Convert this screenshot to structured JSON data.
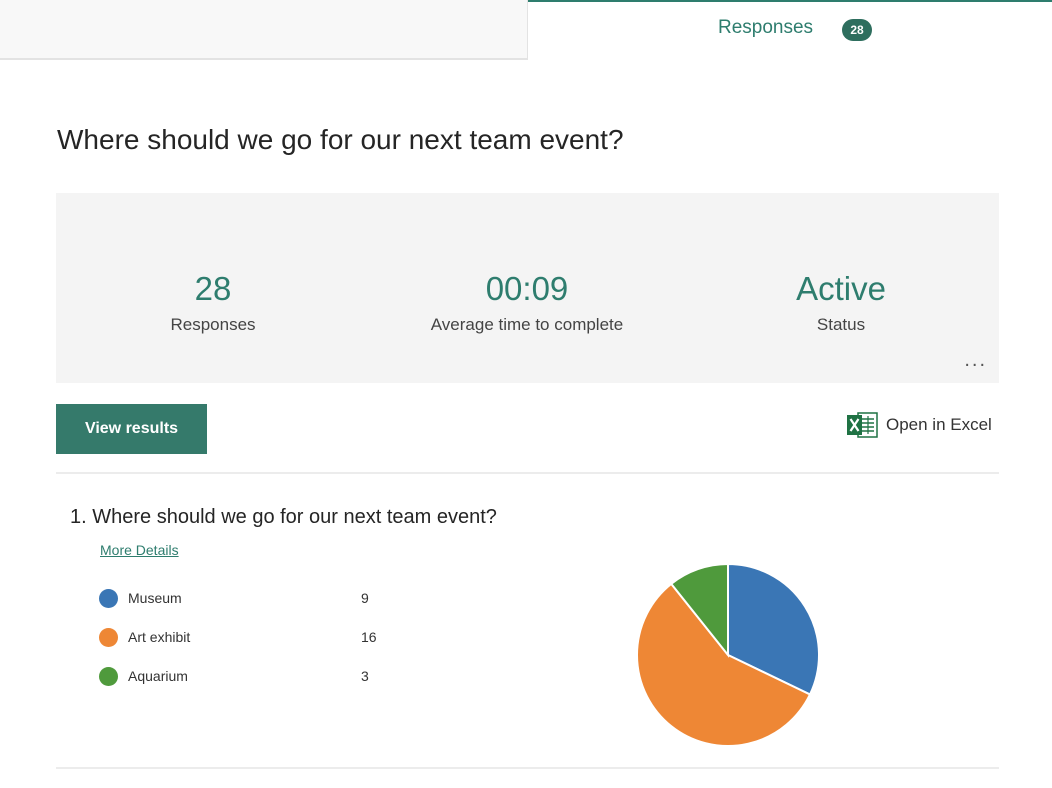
{
  "tabs": {
    "responses_label": "Responses",
    "responses_count": "28"
  },
  "form": {
    "title": "Where should we go for our next team event?"
  },
  "stats": [
    {
      "value": "28",
      "label": "Responses"
    },
    {
      "value": "00:09",
      "label": "Average time to complete"
    },
    {
      "value": "Active",
      "label": "Status"
    }
  ],
  "actions": {
    "more_label": "...",
    "view_results_label": "View results",
    "open_excel_label": "Open in Excel"
  },
  "question": {
    "title": "1.  Where should we go for our next team event?",
    "more_details_label": "More Details"
  },
  "chart_data": {
    "type": "pie",
    "categories": [
      "Museum",
      "Art exhibit",
      "Aquarium"
    ],
    "values": [
      9,
      16,
      3
    ],
    "colors": [
      "#3a76b5",
      "#ee8735",
      "#4f9a3c"
    ]
  },
  "colors": {
    "accent": "#2e7d6e",
    "button": "#357a6b",
    "excel_green": "#1f7244"
  }
}
